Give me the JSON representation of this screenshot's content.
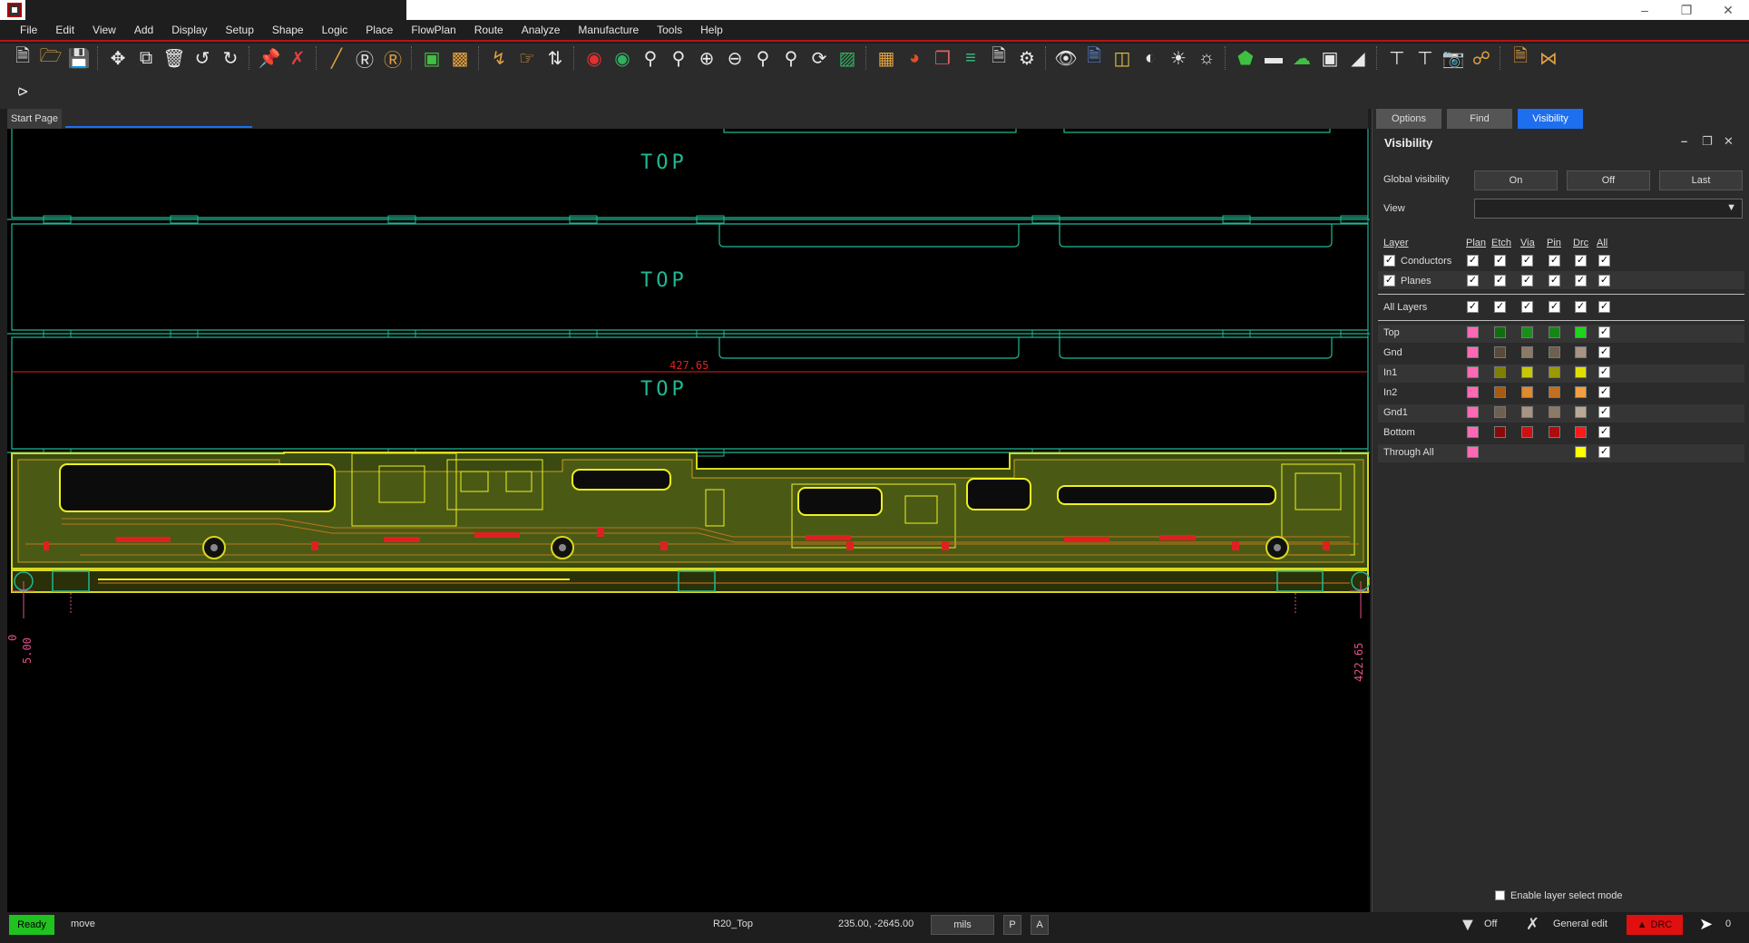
{
  "menubar": {
    "items": [
      "File",
      "Edit",
      "View",
      "Add",
      "Display",
      "Setup",
      "Shape",
      "Logic",
      "Place",
      "FlowPlan",
      "Route",
      "Analyze",
      "Manufacture",
      "Tools",
      "Help"
    ]
  },
  "toolbar": {
    "icons": [
      "new-icon",
      "open-icon",
      "save-icon",
      "move-icon",
      "copy-icon",
      "delete-icon",
      "undo-icon",
      "redo-icon",
      "pin-icon",
      "unpin-icon",
      "line-icon",
      "text-icon",
      "text-edit-icon",
      "component-icon",
      "chip-icon",
      "route-icon",
      "slide-icon",
      "tune-icon",
      "drc-icon",
      "globe-icon",
      "zoom-fit-icon",
      "zoom-in-icon",
      "zoom-out-icon",
      "zoom-prev-icon",
      "zoom-area-icon",
      "refresh-icon",
      "board-icon",
      "grid-icon",
      "color-icon",
      "layers-icon",
      "stack-icon",
      "report-icon",
      "settings-icon",
      "visibility-icon",
      "properties-icon",
      "3d-icon",
      "shade-icon",
      "light-icon",
      "light-off-icon",
      "shape-icon",
      "shape-fill-icon",
      "cloud-icon",
      "select-icon",
      "flip-icon",
      "place-icon",
      "unplace-icon",
      "export-icon",
      "r2a-icon",
      "report2-icon",
      "share-icon"
    ]
  },
  "doctab": {
    "label": "Start Page"
  },
  "canvas": {
    "panel_labels": [
      "TOP",
      "TOP",
      "TOP"
    ],
    "dimension_top": "427.65",
    "dimension_left_a": "0",
    "dimension_left_b": "5.00",
    "dimension_right": "422.65"
  },
  "panel": {
    "tabs": [
      {
        "label": "Options",
        "active": false
      },
      {
        "label": "Find",
        "active": false
      },
      {
        "label": "Visibility",
        "active": true
      }
    ],
    "title": "Visibility",
    "global_visibility_label": "Global visibility",
    "buttons": {
      "on": "On",
      "off": "Off",
      "last": "Last"
    },
    "view_label": "View",
    "view_value": "",
    "columns": [
      "Layer",
      "Plan",
      "Etch",
      "Via",
      "Pin",
      "Drc",
      "All"
    ],
    "groups": [
      {
        "label": "Conductors"
      },
      {
        "label": "Planes"
      }
    ],
    "all_layers_label": "All Layers",
    "layers": [
      {
        "name": "Top",
        "colors": [
          "#ff69b4",
          "#0f6e0f",
          "#1a8f1a",
          "#138613",
          "#1fd41f"
        ]
      },
      {
        "name": "Gnd",
        "colors": [
          "#ff69b4",
          "#5a4a3a",
          "#8c7a66",
          "#6e5f50",
          "#a89484"
        ]
      },
      {
        "name": "In1",
        "colors": [
          "#ff69b4",
          "#7f7f00",
          "#c8c800",
          "#9a9a00",
          "#e0e000"
        ]
      },
      {
        "name": "In2",
        "colors": [
          "#ff69b4",
          "#a85a10",
          "#e08a2a",
          "#c07020",
          "#f0a040"
        ]
      },
      {
        "name": "Gnd1",
        "colors": [
          "#ff69b4",
          "#6e5f50",
          "#a89484",
          "#8c7a66",
          "#b8a898"
        ]
      },
      {
        "name": "Bottom",
        "colors": [
          "#ff69b4",
          "#8a0a0a",
          "#d01010",
          "#b00c0c",
          "#ff1a1a"
        ]
      },
      {
        "name": "Through All",
        "colors": [
          "#ff69b4",
          "",
          "",
          "",
          "#ffff00"
        ]
      }
    ],
    "enable_layer_select": "Enable layer select mode"
  },
  "statusbar": {
    "ready": "Ready",
    "mode": "move",
    "layer": "R20_Top",
    "coords": "235.00, -2645.00",
    "units": "mils",
    "p_button": "P",
    "a_button": "A",
    "filter": "Off",
    "edit_mode": "General edit",
    "drc": "DRC",
    "select_count": "0"
  }
}
